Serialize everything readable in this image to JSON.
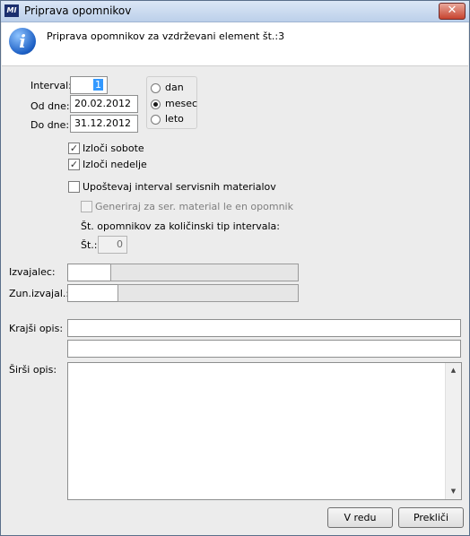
{
  "window": {
    "title": "Priprava opomnikov",
    "app_icon": "MI",
    "close_glyph": "✕"
  },
  "header": {
    "icon": "info-icon",
    "text": "Priprava opomnikov za vzdrževani element št.:3"
  },
  "interval": {
    "label": "Interval:",
    "value": "1"
  },
  "od_dne": {
    "label": "Od dne:",
    "value": "20.02.2012"
  },
  "do_dne": {
    "label": "Do dne:",
    "value": "31.12.2012"
  },
  "period": {
    "options": [
      "dan",
      "mesec",
      "leto"
    ],
    "selected": "mesec"
  },
  "izloci_sobote": {
    "label": "Izloči sobote",
    "checked": true,
    "mark": "✓"
  },
  "izloci_nedelje": {
    "label": "Izloči nedelje",
    "checked": true,
    "mark": "✓"
  },
  "upostevaj": {
    "label": "Upoštevaj interval servisnih materialov",
    "checked": false
  },
  "generiraj": {
    "label": "Generiraj za ser. material le en opomnik",
    "checked": false,
    "disabled": true
  },
  "st_opomnikov": {
    "label": "Št. opomnikov za količinski tip intervala:",
    "st_label": "Št.:",
    "st_value": "0"
  },
  "izvajalec": {
    "label": "Izvajalec:",
    "code": "",
    "name": ""
  },
  "zun_izvajal": {
    "label": "Zun.izvajal.:",
    "code": "",
    "name": ""
  },
  "krajsi_opis": {
    "label": "Krajši opis:",
    "line1": "",
    "line2": ""
  },
  "sirsi_opis": {
    "label": "Širši opis:",
    "value": ""
  },
  "buttons": {
    "ok": "V redu",
    "cancel": "Prekliči"
  },
  "scroll": {
    "up": "▲",
    "down": "▼"
  },
  "colors": {
    "selection": "#3399ff",
    "titlebar": "#bcd0ea",
    "close": "#c7432f"
  }
}
